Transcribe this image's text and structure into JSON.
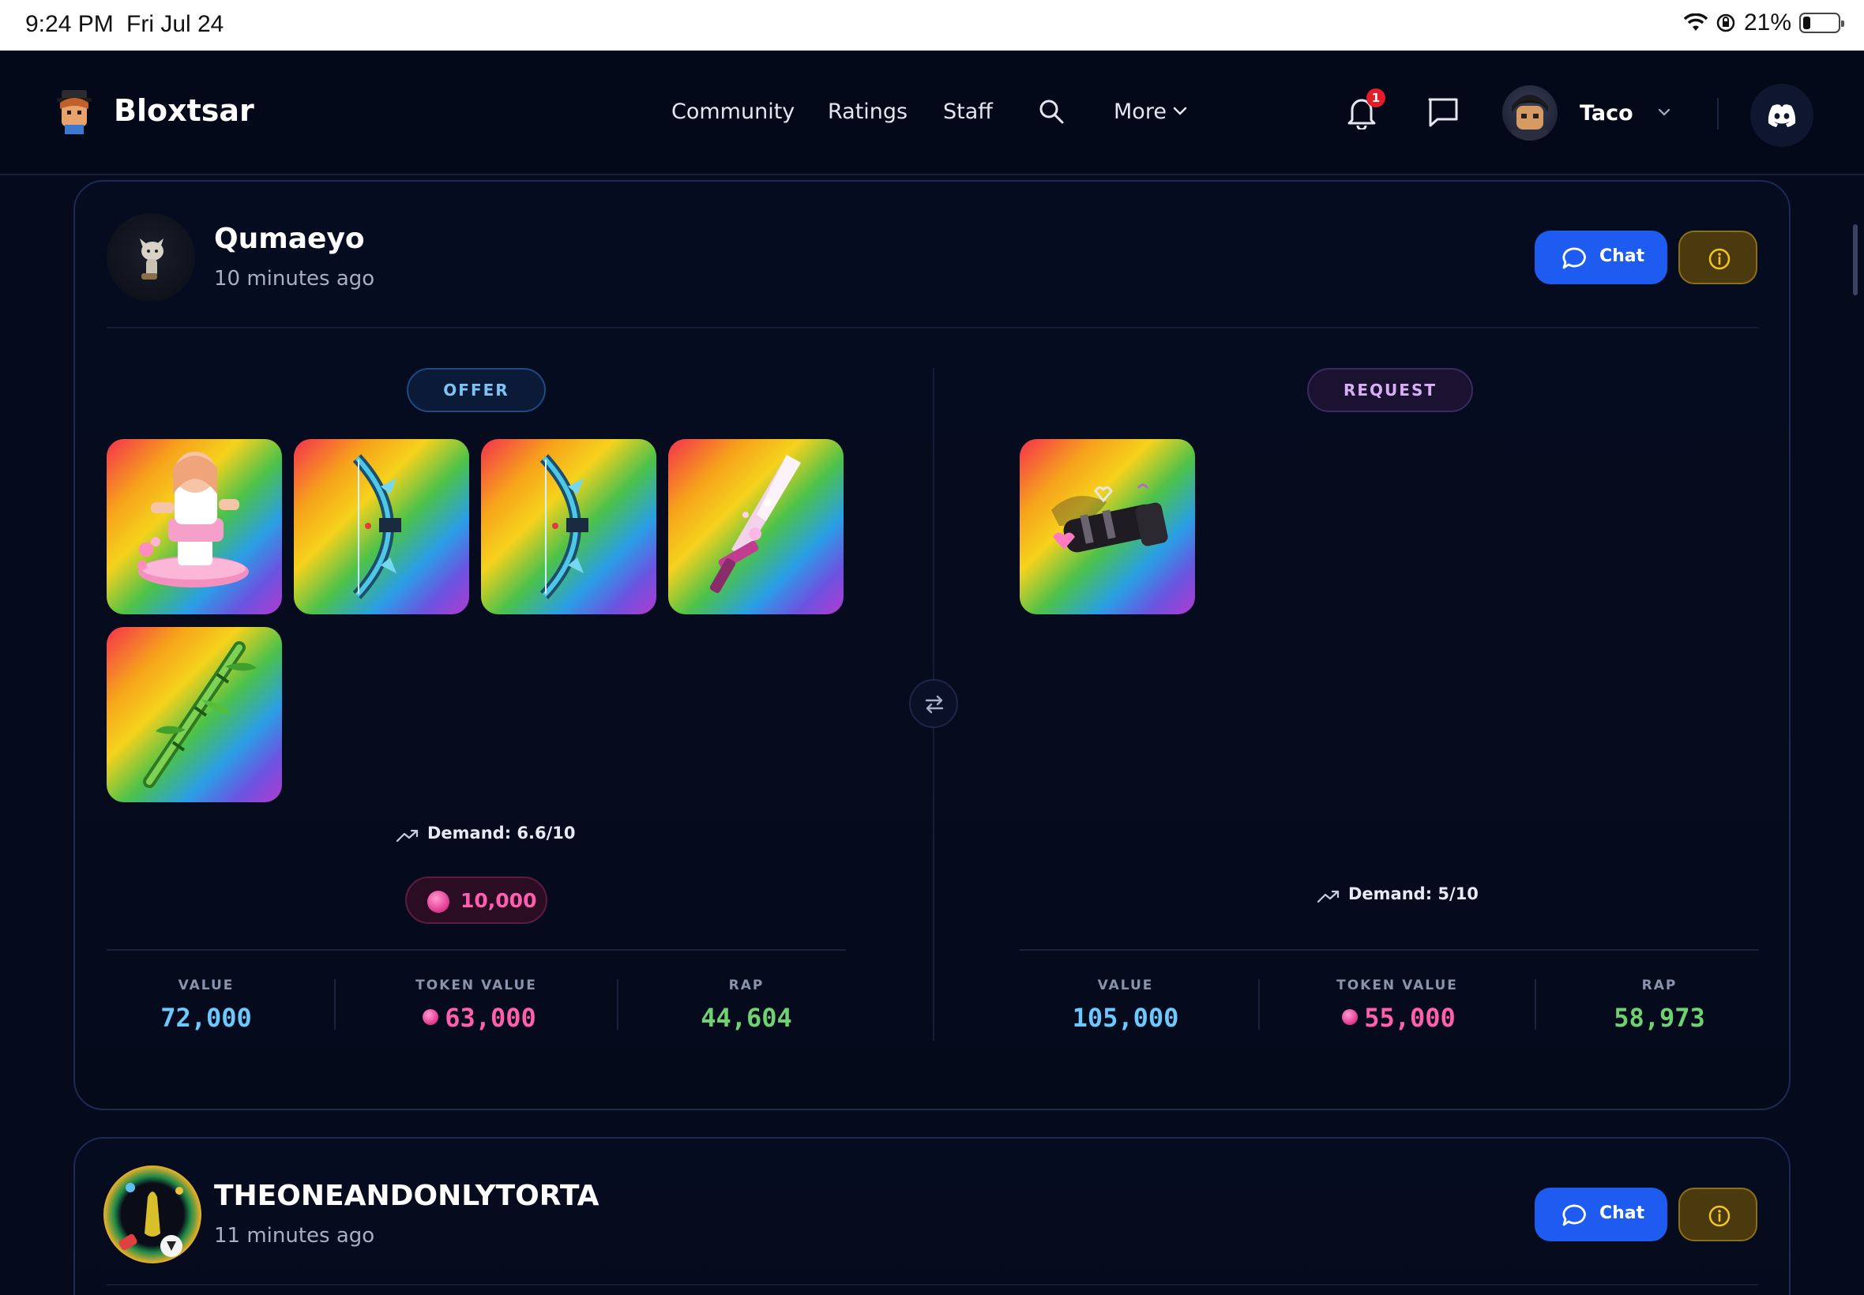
{
  "status_bar": {
    "time": "9:24 PM",
    "date": "Fri Jul 24",
    "battery": "21%",
    "battery_level": 0.21
  },
  "nav": {
    "brand": "Bloxtsar",
    "links": [
      "Community",
      "Ratings",
      "Staff"
    ],
    "more_label": "More",
    "notification_count": "1",
    "user_name": "Taco",
    "icons": [
      "bell-icon",
      "message-icon",
      "search-icon",
      "discord-icon",
      "chevron-down-icon"
    ]
  },
  "trades": [
    {
      "username": "Qumaeyo",
      "time_ago": "10 minutes ago",
      "chat_label": "Chat",
      "offer": {
        "label": "OFFER",
        "items": [
          "skateboard-character",
          "ice-bow",
          "ice-bow",
          "crystal-sword",
          "bamboo-staff"
        ],
        "demand": "Demand: 6.6/10",
        "tokens": "10,000",
        "stats": {
          "value_label": "VALUE",
          "value": "72,000",
          "token_label": "TOKEN VALUE",
          "token_value": "63,000",
          "rap_label": "RAP",
          "rap": "44,604"
        }
      },
      "request": {
        "label": "REQUEST",
        "items": [
          "heart-cannon"
        ],
        "demand": "Demand: 5/10",
        "stats": {
          "value_label": "VALUE",
          "value": "105,000",
          "token_label": "TOKEN VALUE",
          "token_value": "55,000",
          "rap_label": "RAP",
          "rap": "58,973"
        }
      }
    },
    {
      "username": "THEONEANDONLYTORTA",
      "time_ago": "11 minutes ago",
      "chat_label": "Chat"
    }
  ],
  "colors": {
    "background": "#050a1c",
    "chat_button": "#1e5bf0",
    "info_button": "#4a3a0e",
    "value": "#6cc8ff",
    "token": "#ff5fae",
    "rap": "#6ed273"
  }
}
